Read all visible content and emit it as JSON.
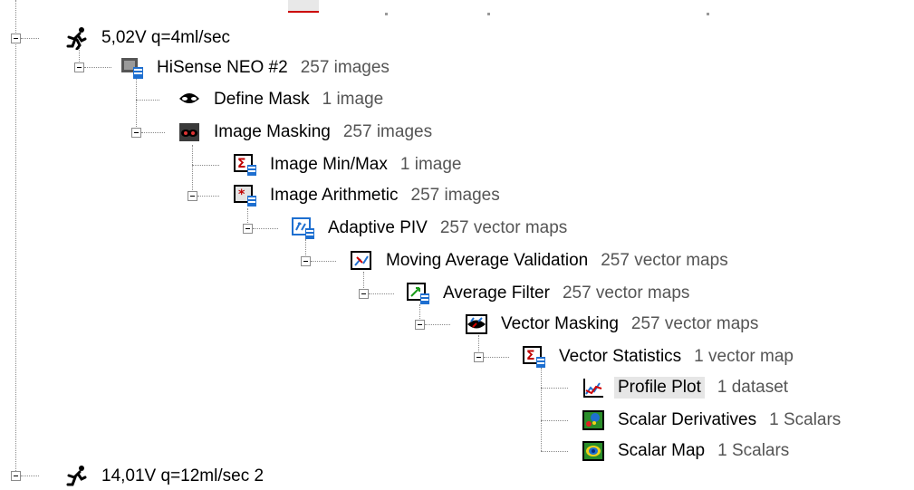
{
  "tree": {
    "nodes": [
      {
        "id": "root1",
        "label": "5,02V q=4ml/sec",
        "count": ""
      },
      {
        "id": "hisense",
        "label": "HiSense NEO #2",
        "count": "257 images"
      },
      {
        "id": "define_mask",
        "label": "Define Mask",
        "count": "1 image"
      },
      {
        "id": "image_masking",
        "label": "Image Masking",
        "count": "257 images"
      },
      {
        "id": "image_minmax",
        "label": "Image Min/Max",
        "count": "1 image"
      },
      {
        "id": "image_arith",
        "label": "Image Arithmetic",
        "count": "257 images"
      },
      {
        "id": "adaptive_piv",
        "label": "Adaptive PIV",
        "count": "257 vector maps"
      },
      {
        "id": "moving_avg",
        "label": "Moving Average Validation",
        "count": "257 vector maps"
      },
      {
        "id": "avg_filter",
        "label": "Average Filter",
        "count": "257 vector maps"
      },
      {
        "id": "vector_masking",
        "label": "Vector Masking",
        "count": "257 vector maps"
      },
      {
        "id": "vector_stats",
        "label": "Vector Statistics",
        "count": "1 vector map"
      },
      {
        "id": "profile_plot",
        "label": "Profile Plot",
        "count": "1 dataset"
      },
      {
        "id": "scalar_deriv",
        "label": "Scalar Derivatives",
        "count": "1 Scalars"
      },
      {
        "id": "scalar_map",
        "label": "Scalar Map",
        "count": "1 Scalars"
      }
    ],
    "next_root_partial": "14,01V q=12ml/sec 2",
    "selected": "Profile Plot"
  },
  "icons": {
    "run": "running-figure-icon",
    "camera": "camera-database-icon",
    "mask": "mask-icon",
    "image_mask": "image-masking-icon",
    "sigma": "sigma-database-icon",
    "arith": "arithmetic-database-icon",
    "piv": "adaptive-piv-icon",
    "validation": "validation-icon",
    "filter": "filter-database-icon",
    "vmask": "vector-mask-icon",
    "profile": "profile-plot-icon",
    "scalar": "scalar-map-icon"
  },
  "colors": {
    "selection": "#e6e6e6",
    "count_text": "#555555",
    "line": "#8a8a8a"
  }
}
